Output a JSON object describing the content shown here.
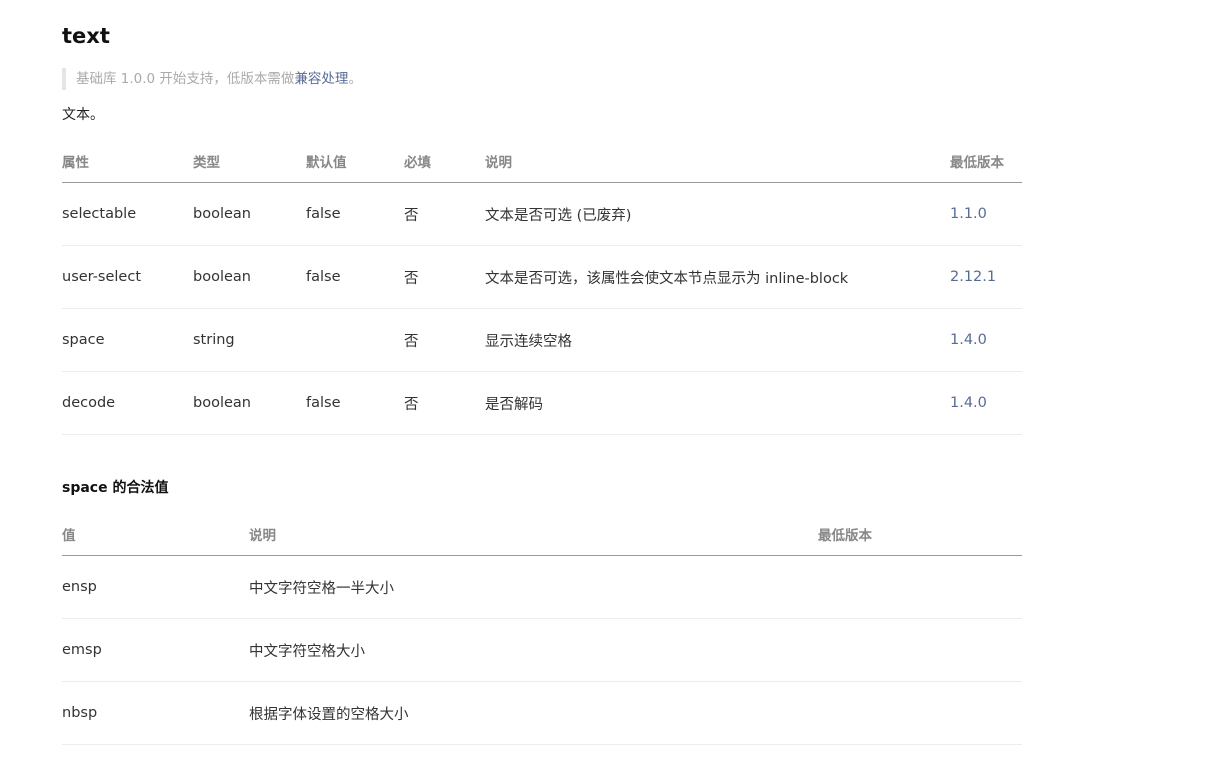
{
  "title": "text",
  "note": {
    "prefix": "基础库 1.0.0 开始支持，低版本需做",
    "link": "兼容处理",
    "suffix": "。"
  },
  "description": "文本。",
  "attr_table": {
    "headers": [
      "属性",
      "类型",
      "默认值",
      "必填",
      "说明",
      "最低版本"
    ],
    "rows": [
      [
        "selectable",
        "boolean",
        "false",
        "否",
        "文本是否可选 (已废弃)",
        "1.1.0"
      ],
      [
        "user-select",
        "boolean",
        "false",
        "否",
        "文本是否可选，该属性会使文本节点显示为 inline-block",
        "2.12.1"
      ],
      [
        "space",
        "string",
        "",
        "否",
        "显示连续空格",
        "1.4.0"
      ],
      [
        "decode",
        "boolean",
        "false",
        "否",
        "是否解码",
        "1.4.0"
      ]
    ]
  },
  "space_section": {
    "title": "space 的合法值",
    "headers": [
      "值",
      "说明",
      "最低版本"
    ],
    "rows": [
      [
        "ensp",
        "中文字符空格一半大小",
        ""
      ],
      [
        "emsp",
        "中文字符空格大小",
        ""
      ],
      [
        "nbsp",
        "根据字体设置的空格大小",
        ""
      ]
    ]
  }
}
